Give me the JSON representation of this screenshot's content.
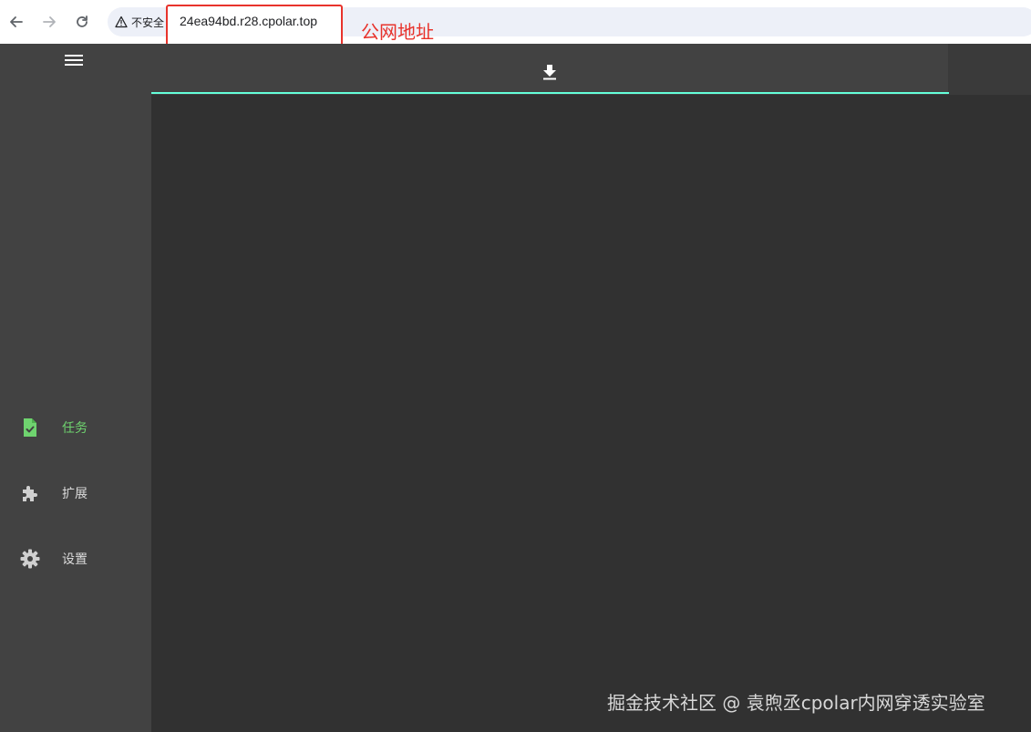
{
  "browser": {
    "security_label": "不安全",
    "url": "24ea94bd.r28.cpolar.top",
    "annotation_label": "公网地址",
    "annotation_color": "#e8332c",
    "icons": [
      "back-arrow-icon",
      "forward-arrow-icon",
      "reload-icon",
      "warning-icon"
    ]
  },
  "sidebar": {
    "menu_icon": "hamburger-menu-icon",
    "items": [
      {
        "label": "任务",
        "icon": "task-file-check-icon",
        "active": true
      },
      {
        "label": "扩展",
        "icon": "puzzle-piece-icon",
        "active": false
      },
      {
        "label": "设置",
        "icon": "gear-icon",
        "active": false
      }
    ]
  },
  "toolbar": {
    "download_icon": "download-icon"
  },
  "watermark": "掘金技术社区 @ 袁煦丞cpolar内网穿透实验室",
  "colors": {
    "sidebar_bg": "#424242",
    "content_bg": "#313131",
    "accent_active": "#6fd46f",
    "tab_indicator": "#64ffda"
  }
}
